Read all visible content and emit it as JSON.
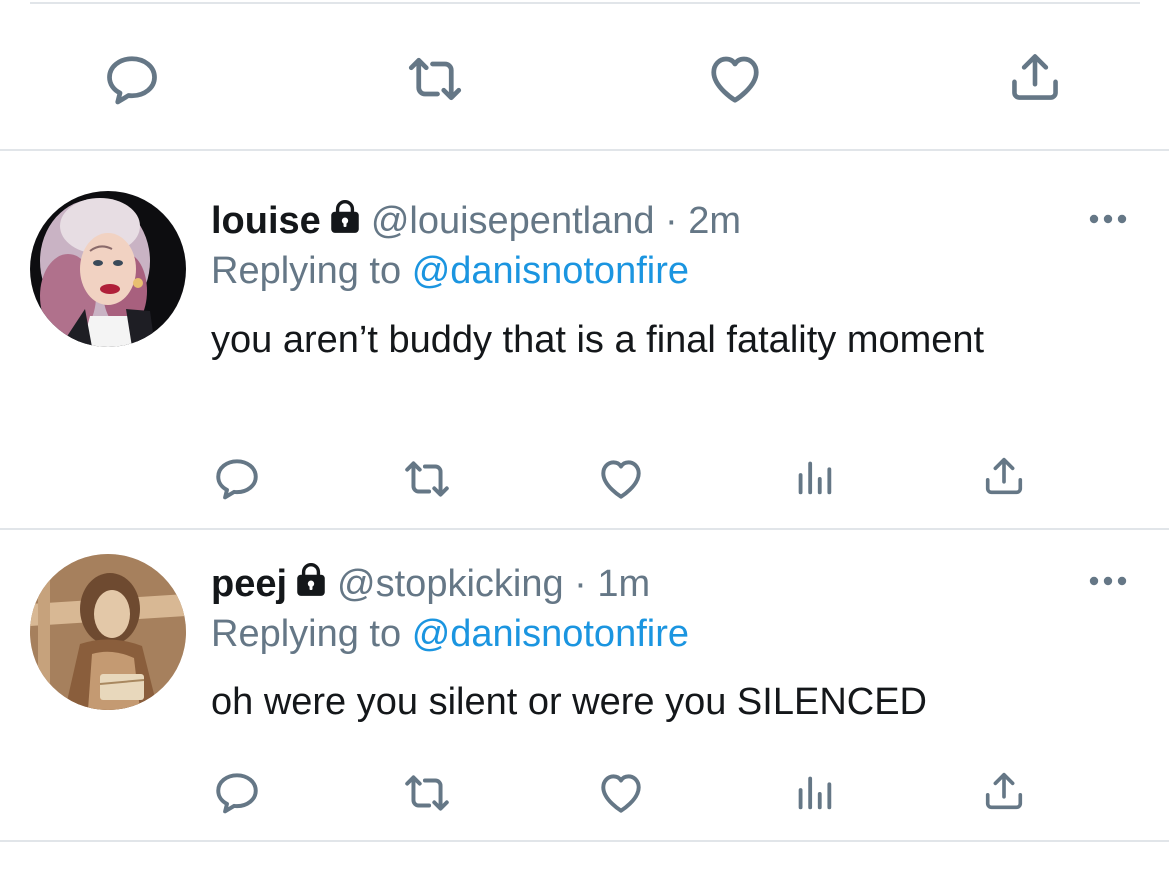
{
  "colors": {
    "text": "#14171a",
    "muted": "#657786",
    "link": "#1b95e0",
    "icon": "#657786",
    "divider": "#e1e5e9"
  },
  "top_actions": {
    "icons": [
      "reply-icon",
      "retweet-icon",
      "like-icon",
      "share-icon"
    ]
  },
  "tweets": [
    {
      "name": "louise",
      "protected": true,
      "handle": "@louisepentland",
      "separator": "·",
      "time": "2m",
      "replying_prefix": "Replying to",
      "replying_to": "@danisnotonfire",
      "text": "you aren’t buddy that is a final fatality moment",
      "actions": [
        "reply-icon",
        "retweet-icon",
        "like-icon",
        "analytics-icon",
        "share-icon"
      ]
    },
    {
      "name": "peej",
      "protected": true,
      "handle": "@stopkicking",
      "separator": "·",
      "time": "1m",
      "replying_prefix": "Replying to",
      "replying_to": "@danisnotonfire",
      "text": "oh were you silent or were you SILENCED",
      "actions": [
        "reply-icon",
        "retweet-icon",
        "like-icon",
        "analytics-icon",
        "share-icon"
      ]
    }
  ]
}
